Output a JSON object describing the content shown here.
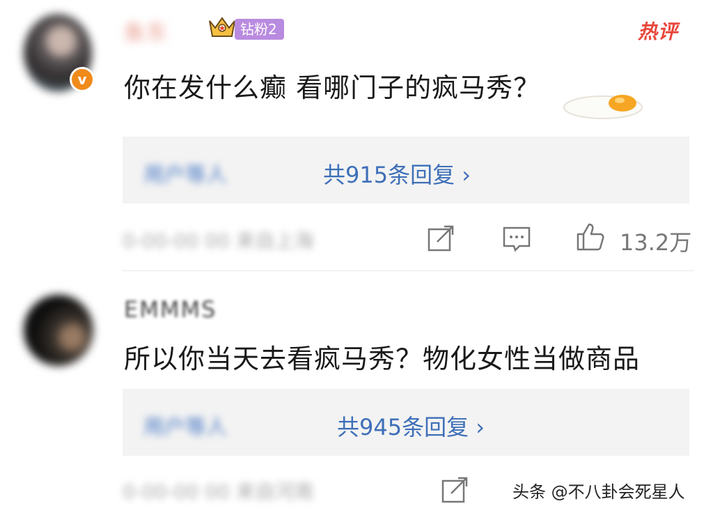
{
  "comments": [
    {
      "username": "鱼东",
      "badge": "钻粉2",
      "hot_label": "热评",
      "text": "你在发什么癫 看哪门子的疯马秀？",
      "reply_names": "用户等人",
      "reply_count": "共915条回复 ›",
      "meta": "0-00-00 00 来自上海",
      "likes": "13.2万"
    },
    {
      "username": "EMMMS",
      "text": "所以你当天去看疯马秀？物化女性当做商品",
      "reply_names": "用户等人",
      "reply_count": "共945条回复 ›",
      "meta": "0-00-00 00 来自河南"
    }
  ],
  "watermark": "头条 @不八卦会死星人",
  "colors": {
    "accent_blue": "#3e6fb8",
    "hot_red": "#e8473b",
    "badge_purple": "#b98be0",
    "verified_orange": "#f08a1b"
  }
}
